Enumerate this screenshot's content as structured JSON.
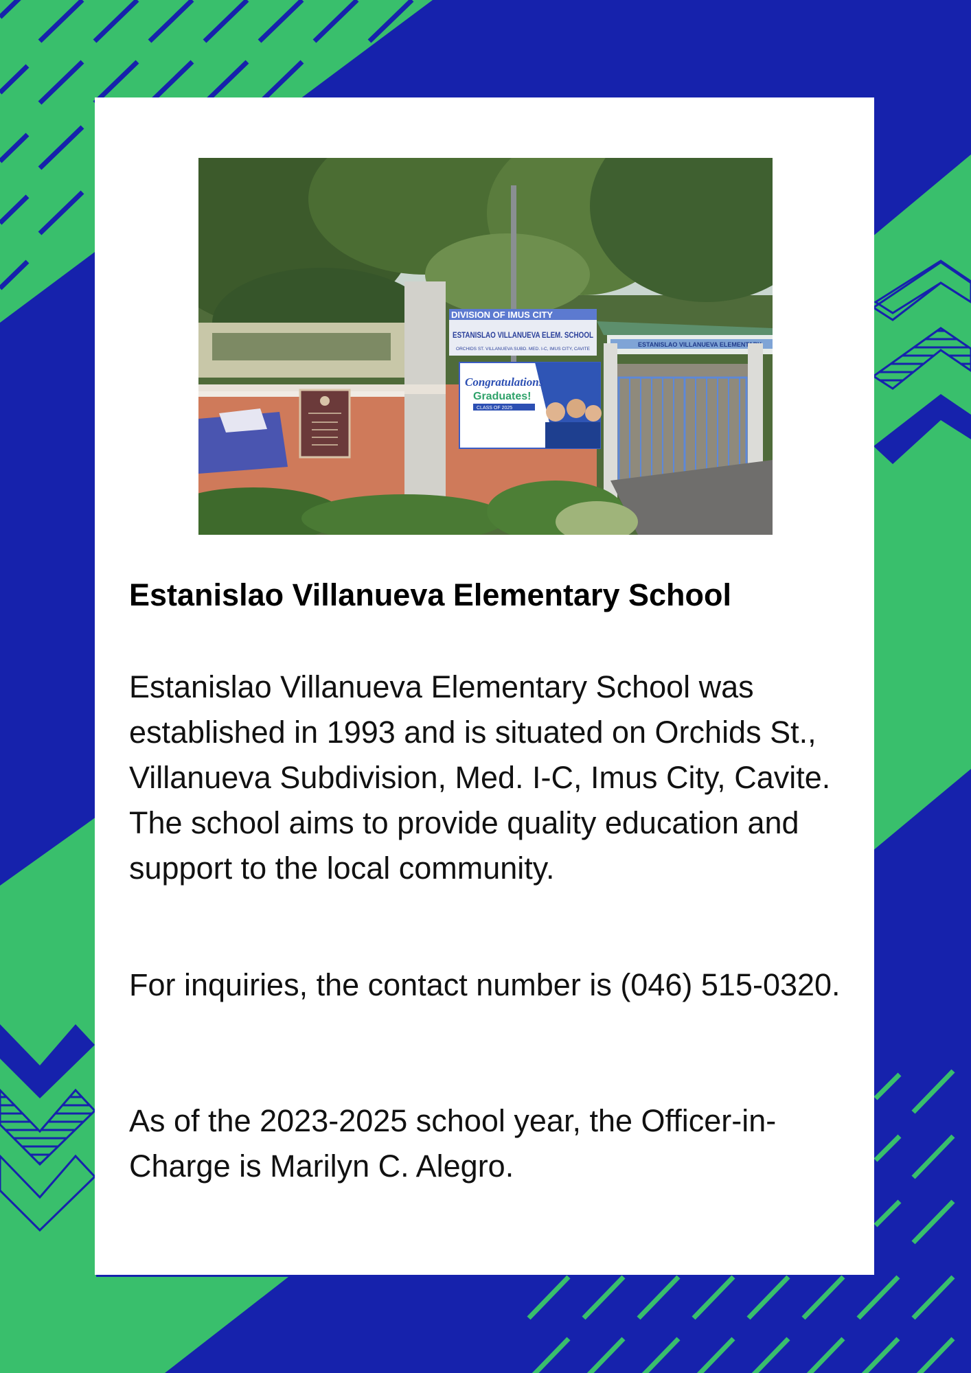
{
  "colors": {
    "blue": "#1622ac",
    "green": "#39bf6c",
    "card": "#ffffff"
  },
  "photo": {
    "banner_top": "DIVISION OF IMUS CITY",
    "banner_school": "ESTANISLAO VILLANUEVA ELEM. SCHOOL",
    "banner_sub": "ORCHIDS ST. VILLANUEVA SUBD. MED. I-C, IMUS CITY, CAVITE",
    "grad_title": "Congratulations",
    "grad_sub": "Graduates!",
    "grad_class": "CLASS OF 2025",
    "gate_sign": "ESTANISLAO VILLANUEVA ELEMENTARY"
  },
  "title": "Estanislao Villanueva Elementary School",
  "paragraphs": {
    "intro": "Estanislao Villanueva Elementary School was established in 1993 and is situated on Orchids St., Villanueva Subdivision, Med. I-C, Imus City, Cavite.",
    "aim": "The school aims to provide quality education and support to the local community.",
    "contact": "For inquiries, the contact number is (046) 515-0320.",
    "officer": "As of the 2023-2025 school year, the Officer-in-Charge is Marilyn C. Alegro."
  }
}
